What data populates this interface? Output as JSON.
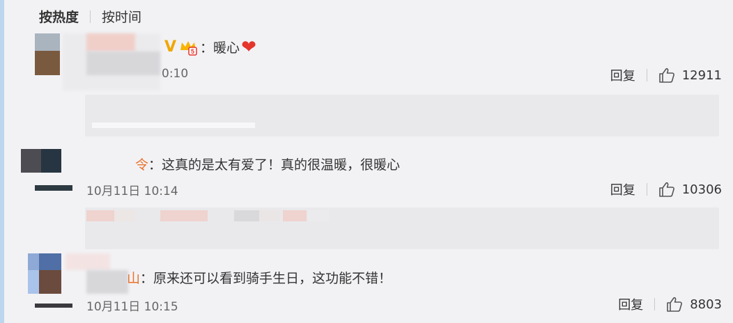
{
  "tabs": {
    "hot": "按热度",
    "time": "按时间"
  },
  "comments": [
    {
      "text": "暖心",
      "colon": "：",
      "time_visible": "0:10",
      "reply_label": "回复",
      "likes": "12911"
    },
    {
      "name_tail": "令",
      "colon": "：",
      "text": "这真的是太有爱了！真的很温暖，很暖心",
      "time_visible": "10月11日 10:14",
      "reply_label": "回复",
      "likes": "10306"
    },
    {
      "name_tail": "山",
      "colon": "：",
      "text": "原来还可以看到骑手生日，这功能不错！",
      "time_visible": "10月11日 10:15",
      "reply_label": "回复",
      "likes": "8803"
    }
  ],
  "colors": {
    "accent_border": "#bcd6ee",
    "background": "#f2f2f5",
    "heart": "#e5352c",
    "vip_gold": "#f0a700"
  },
  "icons": {
    "like": "thumbs-up-icon",
    "heart": "heart-icon",
    "verified": "verified-v-icon",
    "vip": "vip-crown-icon"
  }
}
